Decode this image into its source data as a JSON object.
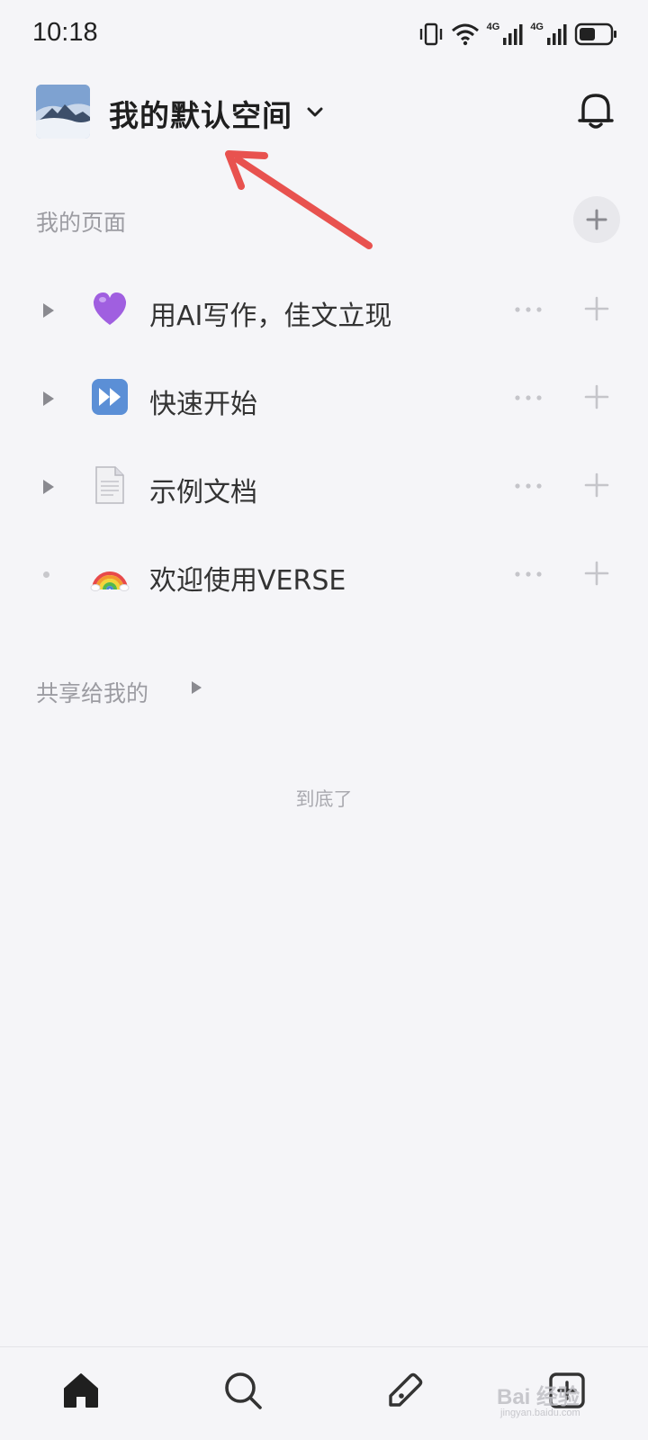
{
  "status_bar": {
    "time": "10:18",
    "network_1": "4G",
    "network_2": "4G",
    "icons": [
      "vibrate-icon",
      "wifi-icon",
      "signal-icon",
      "signal-icon",
      "battery-icon"
    ],
    "battery_level": 0.45
  },
  "header": {
    "workspace_name": "我的默认空间",
    "avatar": "workspace-avatar",
    "icons": [
      "chevron-down-icon",
      "bell-icon"
    ]
  },
  "my_pages": {
    "title": "我的页面",
    "items": [
      {
        "icon": "purple-heart-emoji",
        "label": "用AI写作，佳文立现",
        "expandable": true
      },
      {
        "icon": "fast-forward-emoji",
        "label": "快速开始",
        "expandable": true
      },
      {
        "icon": "page-emoji",
        "label": "示例文档",
        "expandable": true
      },
      {
        "icon": "rainbow-emoji",
        "label": "欢迎使用VERSE",
        "expandable": false
      }
    ]
  },
  "shared": {
    "title": "共享给我的"
  },
  "end_text": "到底了",
  "tab_bar": {
    "tabs": [
      "home-icon",
      "search-icon",
      "edit-icon",
      "add-icon"
    ]
  },
  "watermark": {
    "text": "Bai 经验",
    "sub": "jingyan.baidu.com"
  },
  "colors": {
    "background": "#f5f5f8",
    "annotation_arrow": "#e8524f",
    "secondary_text": "#9c9ca2"
  }
}
